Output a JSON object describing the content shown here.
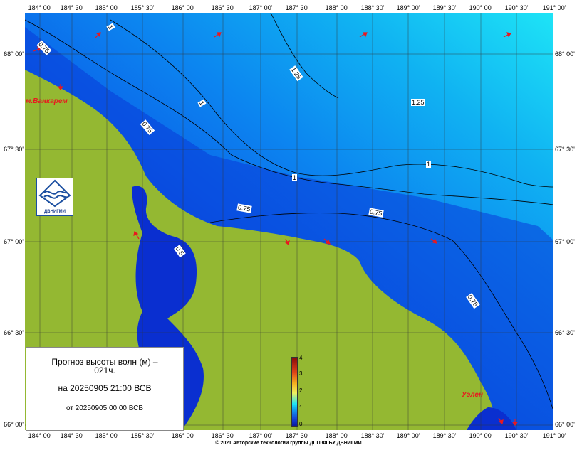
{
  "axes": {
    "lon_labels": [
      "184° 00'",
      "184° 30'",
      "185° 00'",
      "185° 30'",
      "186° 00'",
      "186° 30'",
      "187° 00'",
      "187° 30'",
      "188° 00'",
      "188° 30'",
      "189° 00'",
      "189° 30'",
      "190° 00'",
      "190° 30'",
      "191° 00'"
    ],
    "lat_labels": [
      "68° 00'",
      "67° 30'",
      "67° 00'",
      "66° 30'",
      "66° 00'"
    ]
  },
  "legend": {
    "line1": "Прогноз высоты волн (м) –",
    "line2": "021ч.",
    "line3": "на 20250905 21:00 ВСВ",
    "line4": "от 20250905 00:00 ВСВ"
  },
  "colorbar": {
    "labels": [
      "4",
      "3",
      "2",
      "1",
      "0"
    ]
  },
  "logo": {
    "text": "ДВНИГМИ"
  },
  "places": {
    "vankarem": "м.Ванкарем",
    "uelen": "Уэлен"
  },
  "contour_labels": {
    "c1": "0.75",
    "c2": "1",
    "c3": "1.25",
    "c4": "1",
    "c5": "1.25",
    "c6": "0.75",
    "c7": "1",
    "c8": "1",
    "c9": "0.75",
    "c10": "0.75",
    "c11": "0.75",
    "c12": "0.5"
  },
  "footer": {
    "copyright": "© 2021 Авторские технологии группы ДПП ФГБУ ДВНИГМИ"
  },
  "colors": {
    "land": "#94b832",
    "deep_sea": "#0a2fd0",
    "open_sea": "#1ec8f0",
    "arrow": "#e8191f"
  }
}
